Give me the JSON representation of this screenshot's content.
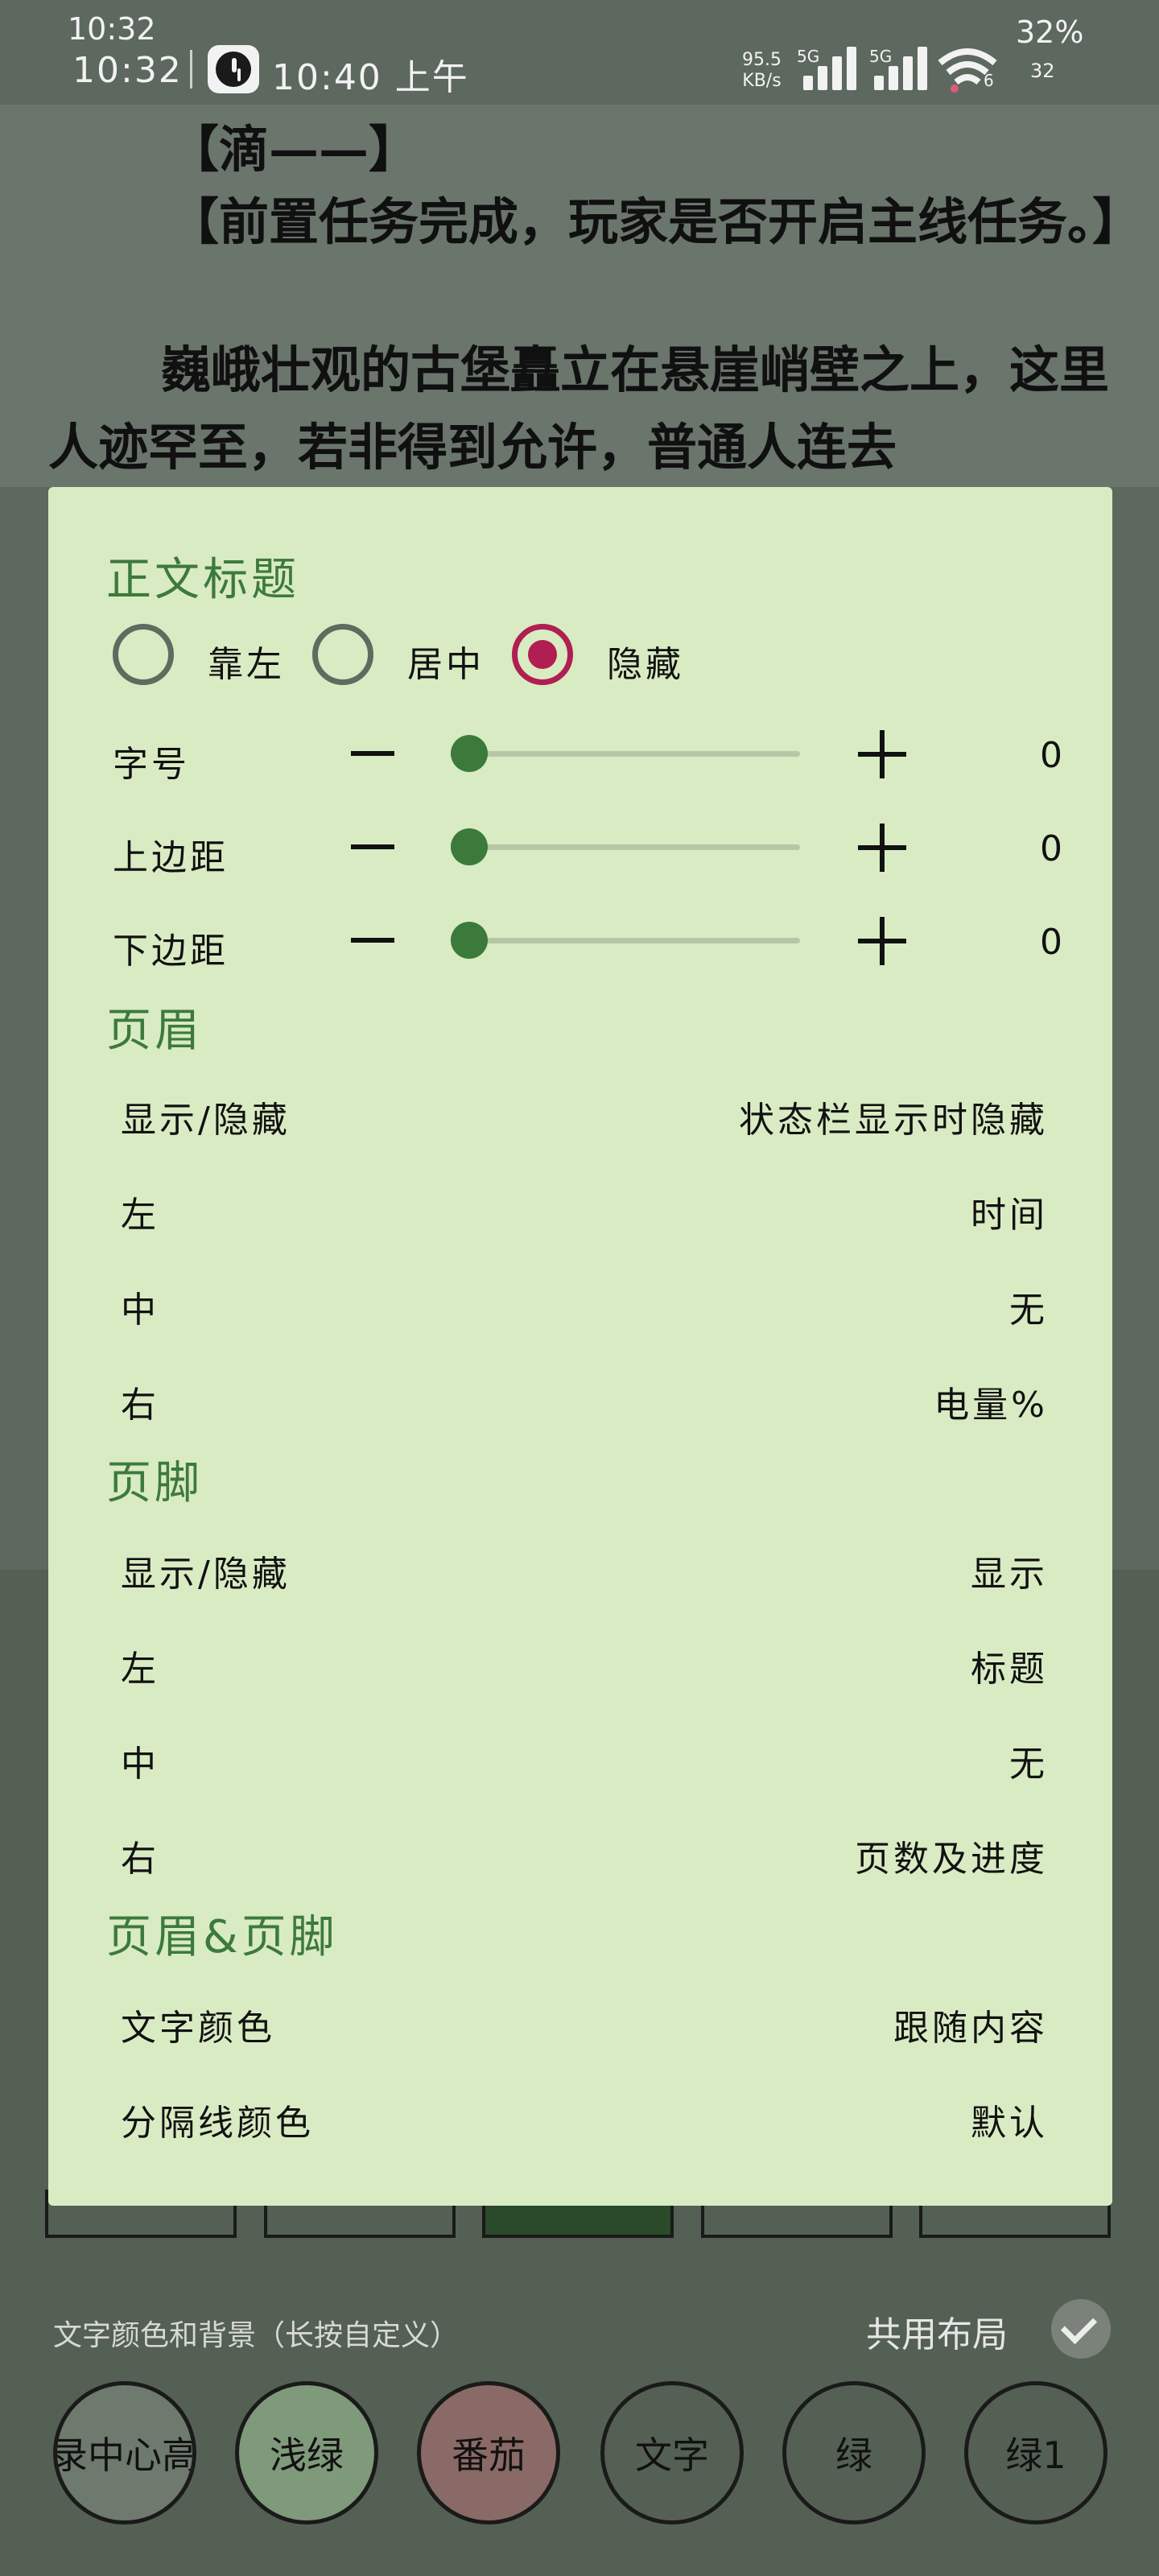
{
  "status_bar": {
    "time_top": "10:32",
    "time": "10:32",
    "time2": "10:40 上午",
    "net_speed_value": "95.5",
    "net_speed_unit": "KB/s",
    "sim1_label": "5G",
    "sim2_label": "5G",
    "wifi_label": "6",
    "battery": "32%",
    "battery_small": "32",
    "icons": [
      "clock-app-icon",
      "signal-icon",
      "signal-icon",
      "wifi-icon"
    ]
  },
  "reader": {
    "line1": "【滴——】",
    "line2": "【前置任务完成，玩家是否开启主线任务。】",
    "line3": "巍峨壮观的古堡矗立在悬崖峭壁之上，这里人迹罕至，若非得到允许，普通人连去"
  },
  "dialog": {
    "title_section": {
      "heading": "正文标题",
      "align_options": [
        {
          "label": "靠左",
          "checked": false
        },
        {
          "label": "居中",
          "checked": false
        },
        {
          "label": "隐藏",
          "checked": true
        }
      ],
      "sliders": [
        {
          "label": "字号",
          "value": "0",
          "level": 0
        },
        {
          "label": "上边距",
          "value": "0",
          "level": 0
        },
        {
          "label": "下边距",
          "value": "0",
          "level": 0
        }
      ]
    },
    "header_section": {
      "heading": "页眉",
      "rows": [
        {
          "label": "显示/隐藏",
          "value": "状态栏显示时隐藏"
        },
        {
          "label": "左",
          "value": "时间"
        },
        {
          "label": "中",
          "value": "无"
        },
        {
          "label": "右",
          "value": "电量%"
        }
      ]
    },
    "footer_section": {
      "heading": "页脚",
      "rows": [
        {
          "label": "显示/隐藏",
          "value": "显示"
        },
        {
          "label": "左",
          "value": "标题"
        },
        {
          "label": "中",
          "value": "无"
        },
        {
          "label": "右",
          "value": "页数及进度"
        }
      ]
    },
    "both_section": {
      "heading": "页眉&页脚",
      "rows": [
        {
          "label": "文字颜色",
          "value": "跟随内容"
        },
        {
          "label": "分隔线颜色",
          "value": "默认"
        }
      ]
    }
  },
  "bottom": {
    "hint": "文字颜色和背景（长按自定义）",
    "share_layout": "共用布局",
    "themes": [
      {
        "label": "录中心高",
        "color": "#6f7a6f"
      },
      {
        "label": "浅绿",
        "color": "#7f9a7a"
      },
      {
        "label": "番茄",
        "color": "#8a6a66"
      },
      {
        "label": "文字",
        "color": "#5d685f"
      },
      {
        "label": "绿",
        "color": "#5d685f"
      },
      {
        "label": "绿1",
        "color": "#5d685f"
      }
    ]
  },
  "colors": {
    "accent": "#3c7a3c",
    "radio_checked": "#b01e52",
    "dialog_bg": "#d9ebc3"
  }
}
